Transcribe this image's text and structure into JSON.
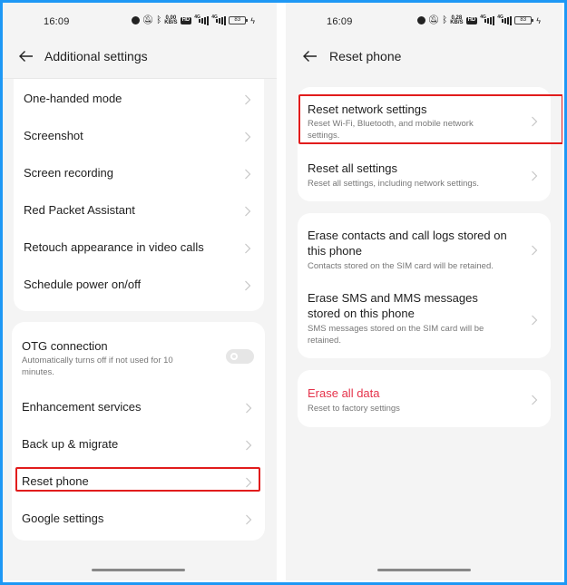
{
  "left_screen": {
    "status": {
      "time": "16:09",
      "net_speed_value": "0.00",
      "net_speed_unit": "KB/S",
      "hd_label": "HD",
      "sim1_gen": "4G",
      "sim2_gen": "4G",
      "battery": "83"
    },
    "title": "Additional settings",
    "groups": [
      {
        "items": [
          {
            "label": "One-handed mode"
          },
          {
            "label": "Screenshot"
          },
          {
            "label": "Screen recording"
          },
          {
            "label": "Red Packet Assistant"
          },
          {
            "label": "Retouch appearance in video calls"
          },
          {
            "label": "Schedule power on/off"
          }
        ]
      },
      {
        "items": [
          {
            "label": "OTG connection",
            "description": "Automatically turns off if not used for 10 minutes.",
            "toggle": "off"
          },
          {
            "label": "Enhancement services"
          },
          {
            "label": "Back up & migrate"
          },
          {
            "label": "Reset phone",
            "highlighted": true
          },
          {
            "label": "Google settings"
          }
        ]
      }
    ]
  },
  "right_screen": {
    "status": {
      "time": "16:09",
      "net_speed_value": "0.28",
      "net_speed_unit": "KB/S",
      "hd_label": "HD",
      "sim1_gen": "4G",
      "sim2_gen": "4G",
      "battery": "83"
    },
    "title": "Reset phone",
    "groups": [
      {
        "items": [
          {
            "label": "Reset network settings",
            "description": "Reset Wi-Fi, Bluetooth, and mobile network settings.",
            "highlighted": true
          },
          {
            "label": "Reset all settings",
            "description": "Reset all settings, including network settings."
          }
        ]
      },
      {
        "items": [
          {
            "label": "Erase contacts and call logs stored on this phone",
            "description": "Contacts stored on the SIM card will be retained."
          },
          {
            "label": "Erase SMS and MMS messages stored on this phone",
            "description": "SMS messages stored on the SIM card will be retained."
          }
        ]
      },
      {
        "items": [
          {
            "label": "Erase all data",
            "description": "Reset to factory settings",
            "danger": true
          }
        ]
      }
    ]
  },
  "colors": {
    "frame_border": "#1e98f5",
    "highlight_box": "#e11c1c",
    "danger_text": "#e5334b",
    "screen_bg": "#f4f4f4",
    "card_bg": "#ffffff"
  }
}
